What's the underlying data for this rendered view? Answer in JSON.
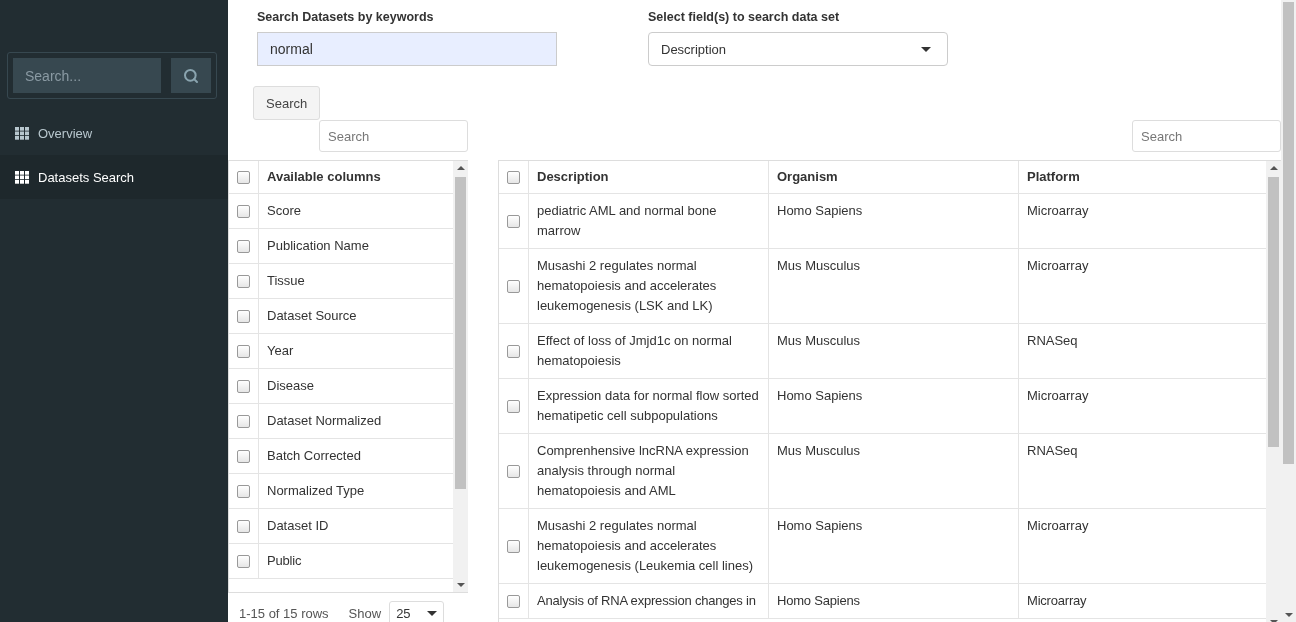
{
  "sidebar": {
    "search_placeholder": "Search...",
    "items": [
      {
        "label": "Overview",
        "selected": false
      },
      {
        "label": "Datasets Search",
        "selected": true
      }
    ]
  },
  "search_form": {
    "keyword_label": "Search Datasets by keywords",
    "keyword_value": "normal",
    "field_label": "Select field(s) to search data set",
    "field_value": "Description",
    "button": "Search"
  },
  "columns_panel": {
    "search_placeholder": "Search",
    "header_checked": false,
    "header": "Available columns",
    "items": [
      {
        "label": "Score",
        "checked": false
      },
      {
        "label": "Publication Name",
        "checked": false
      },
      {
        "label": "Tissue",
        "checked": false
      },
      {
        "label": "Dataset Source",
        "checked": false
      },
      {
        "label": "Year",
        "checked": false
      },
      {
        "label": "Disease",
        "checked": false
      },
      {
        "label": "Dataset Normalized",
        "checked": false
      },
      {
        "label": "Batch Corrected",
        "checked": false
      },
      {
        "label": "Normalized Type",
        "checked": false
      },
      {
        "label": "Dataset ID",
        "checked": false
      },
      {
        "label": "Public",
        "checked": false
      }
    ],
    "footer": {
      "rows_info": "1-15 of 15 rows",
      "show_label": "Show",
      "page_size": "25"
    }
  },
  "results": {
    "search_placeholder": "Search",
    "header_checked": false,
    "columns": [
      "Description",
      "Organism",
      "Platform"
    ],
    "rows": [
      {
        "checked": false,
        "description": "pediatric AML and normal bone marrow",
        "organism": "Homo Sapiens",
        "platform": "Microarray"
      },
      {
        "checked": false,
        "description": "Musashi 2 regulates normal hematopoiesis and accelerates leukemogenesis (LSK and LK)",
        "organism": "Mus Musculus",
        "platform": "Microarray"
      },
      {
        "checked": false,
        "description": "Effect of loss of Jmjd1c on normal hematopoiesis",
        "organism": "Mus Musculus",
        "platform": "RNASeq"
      },
      {
        "checked": false,
        "description": "Expression data for normal flow sorted hematipetic cell subpopulations",
        "organism": "Homo Sapiens",
        "platform": "Microarray"
      },
      {
        "checked": false,
        "description": "Comprenhensive lncRNA expression analysis through normal hematopoiesis and AML",
        "organism": "Mus Musculus",
        "platform": "RNASeq"
      },
      {
        "checked": false,
        "description": "Musashi 2 regulates normal hematopoiesis and accelerates leukemogenesis (Leukemia cell lines)",
        "organism": "Homo Sapiens",
        "platform": "Microarray"
      },
      {
        "checked": false,
        "description": "Analysis of RNA expression changes in",
        "organism": "Homo Sapiens",
        "platform": "Microarray"
      }
    ]
  }
}
